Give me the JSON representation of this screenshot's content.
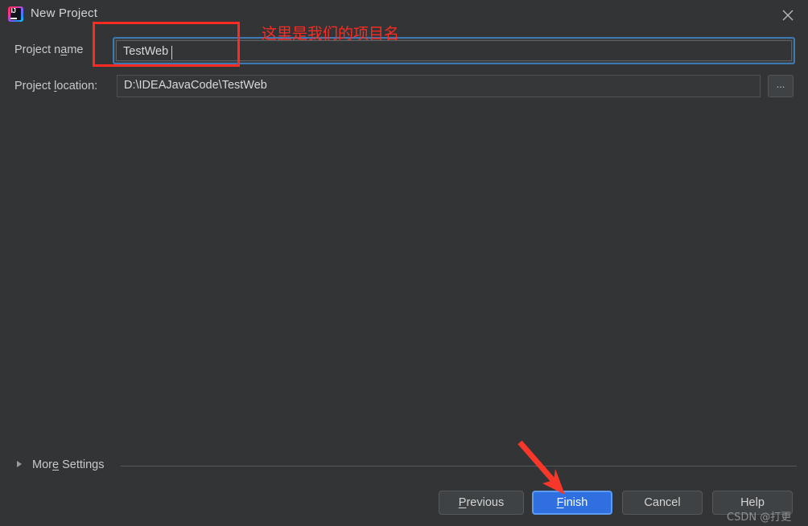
{
  "window": {
    "title": "New Project",
    "app_icon": "intellij-idea-icon",
    "icon_text": "IJ",
    "close_icon": "close-icon"
  },
  "form": {
    "project_name": {
      "label": "Project name",
      "mnemonic_prefix": "Project n",
      "mnemonic_char": "a",
      "mnemonic_suffix": "me",
      "value": "TestWeb",
      "focused": true
    },
    "project_location": {
      "label": "Project location:",
      "mnemonic_prefix": "Project ",
      "mnemonic_char": "l",
      "mnemonic_suffix": "ocation:",
      "value": "D:\\IDEAJavaCode\\TestWeb"
    },
    "browse_button": {
      "label": "...",
      "icon": "ellipsis-icon"
    }
  },
  "more_settings": {
    "label": "More Settings",
    "mnemonic_prefix": "Mor",
    "mnemonic_char": "e",
    "mnemonic_suffix": " Settings",
    "expanded": false,
    "triangle_icon": "chevron-right-icon"
  },
  "buttons": {
    "previous": {
      "label": "Previous",
      "mnemonic_char": "P",
      "mnemonic_suffix": "revious"
    },
    "finish": {
      "label": "Finish",
      "mnemonic_char": "F",
      "mnemonic_suffix": "inish",
      "primary": true
    },
    "cancel": {
      "label": "Cancel"
    },
    "help": {
      "label": "Help"
    }
  },
  "annotations": {
    "callout_text": "这里是我们的项目名",
    "box_target": "project-name-input",
    "arrow_target": "finish-button"
  },
  "watermark": {
    "text": "CSDN @打更"
  },
  "colors": {
    "background": "#333436",
    "accent_blue": "#2f6fe0",
    "focus_ring": "#3d7ab3",
    "annotation_red": "#ff2b22",
    "text": "#d4d4d4"
  }
}
